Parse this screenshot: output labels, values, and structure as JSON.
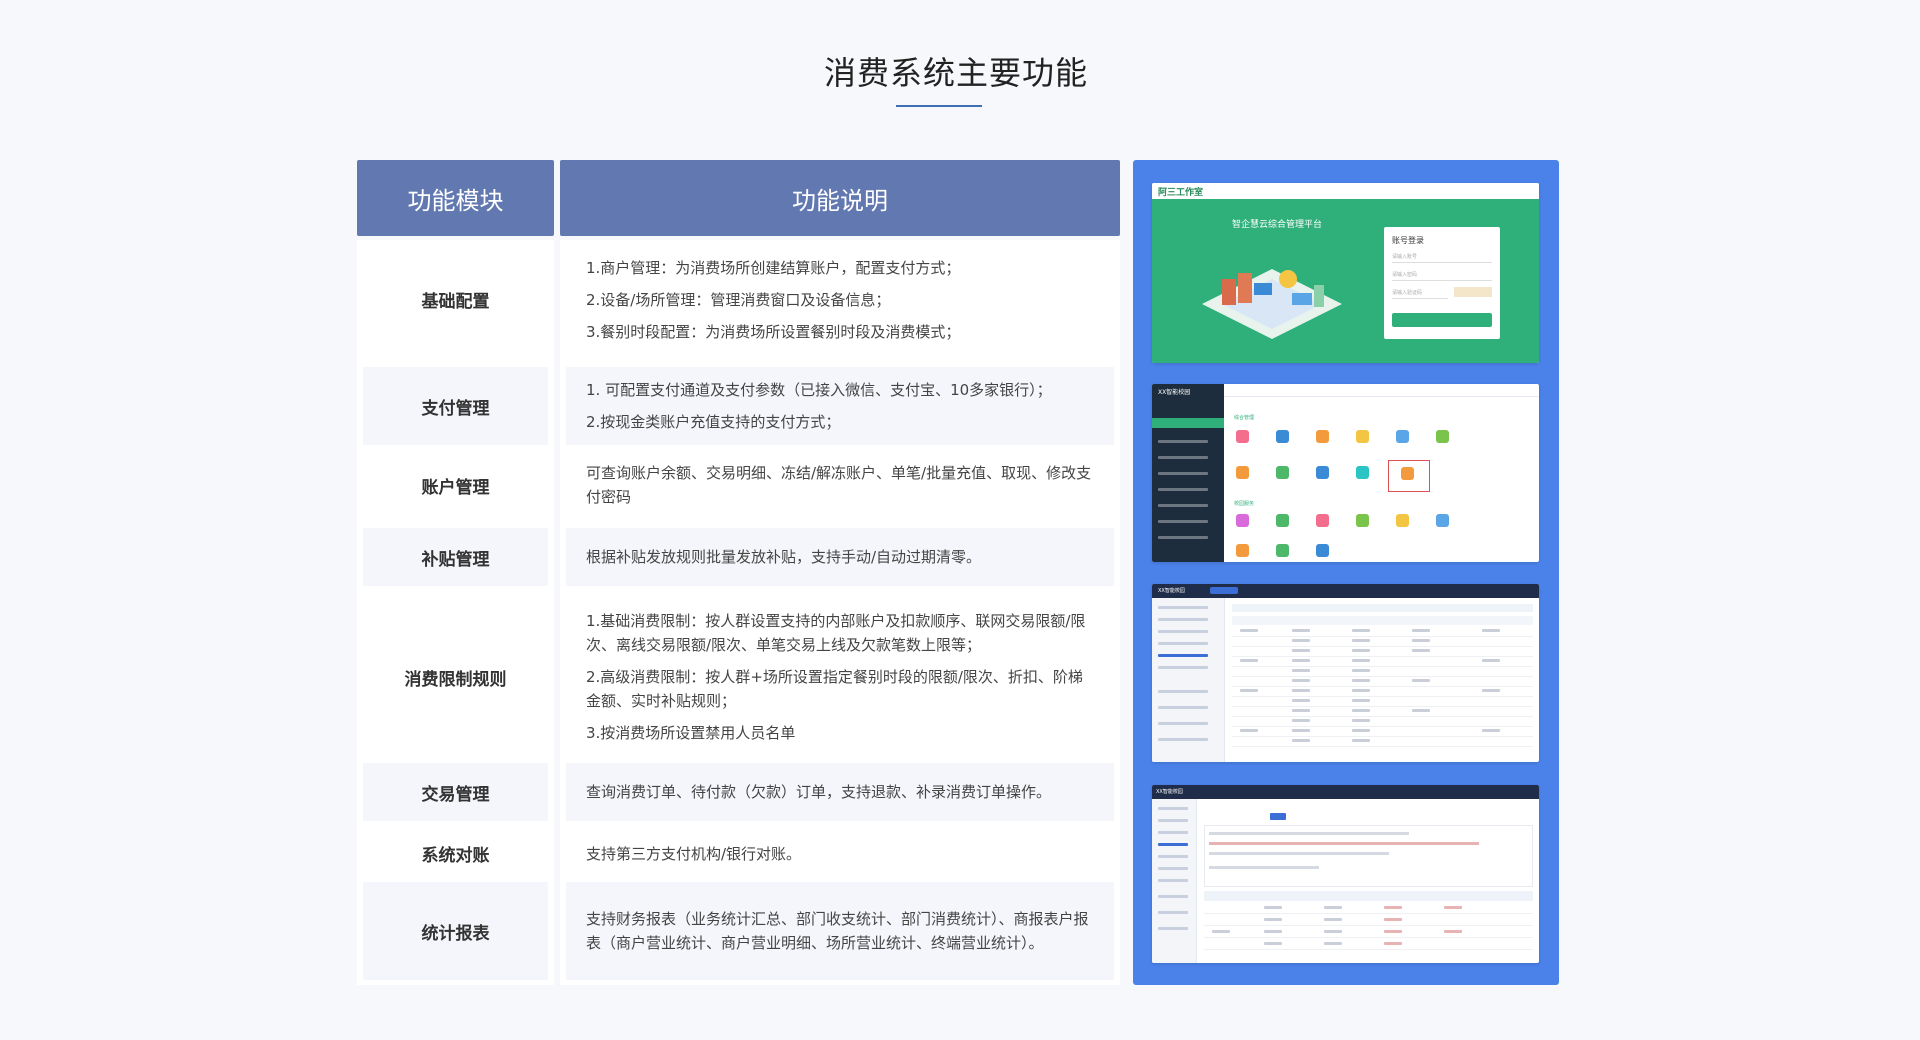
{
  "page": {
    "title": "消费系统主要功能"
  },
  "table": {
    "header_module": "功能模块",
    "header_description": "功能说明",
    "rows": [
      {
        "module": "基础配置",
        "lines": [
          "1.商户管理：为消费场所创建结算账户，配置支付方式；",
          "2.设备/场所管理：管理消费窗口及设备信息；",
          "3.餐别时段配置：为消费场所设置餐别时段及消费模式；"
        ]
      },
      {
        "module": "支付管理",
        "lines": [
          "1. 可配置支付通道及支付参数（已接入微信、支付宝、10多家银行）；",
          "2.按现金类账户充值支持的支付方式；"
        ]
      },
      {
        "module": "账户管理",
        "lines": [
          "可查询账户余额、交易明细、冻结/解冻账户、单笔/批量充值、取现、修改支付密码"
        ]
      },
      {
        "module": "补贴管理",
        "lines": [
          "根据补贴发放规则批量发放补贴，支持手动/自动过期清零。"
        ]
      },
      {
        "module": "消费限制规则",
        "lines": [
          "1.基础消费限制：按人群设置支持的内部账户及扣款顺序、联网交易限额/限次、离线交易限额/限次、单笔交易上线及欠款笔数上限等；",
          "2.高级消费限制：按人群+场所设置指定餐别时段的限额/限次、折扣、阶梯金额、实时补贴规则；",
          "3.按消费场所设置禁用人员名单"
        ]
      },
      {
        "module": "交易管理",
        "lines": [
          "查询消费订单、待付款（欠款）订单，支持退款、补录消费订单操作。"
        ]
      },
      {
        "module": "系统对账",
        "lines": [
          "支持第三方支付机构/银行对账。"
        ]
      },
      {
        "module": "统计报表",
        "lines": [
          "支持财务报表（业务统计汇总、部门收支统计、部门消费统计）、商报表户报表（商户营业统计、商户营业明细、场所营业统计、终端营业统计）。"
        ]
      }
    ]
  },
  "screenshots": {
    "login": {
      "logo": "阿三工作室",
      "subtitle": "智企慧云综合管理平台",
      "card_title": "账号登录",
      "fields": [
        "请输入账号",
        "请输入密码",
        "请输入验证码"
      ]
    },
    "dashboard": {
      "school": "XX智能校园",
      "section_1": "综合管理",
      "section_2": "校园服务"
    },
    "rules": {
      "school": "XX智能校园"
    },
    "report": {
      "school": "XX智能校园"
    }
  },
  "colors": {
    "header_bg": "#6278b0",
    "accent_blue": "#4b82ea",
    "title_underline": "#3f6fb5",
    "login_green": "#2fb07a",
    "dark_sidebar": "#1e2d3d"
  }
}
